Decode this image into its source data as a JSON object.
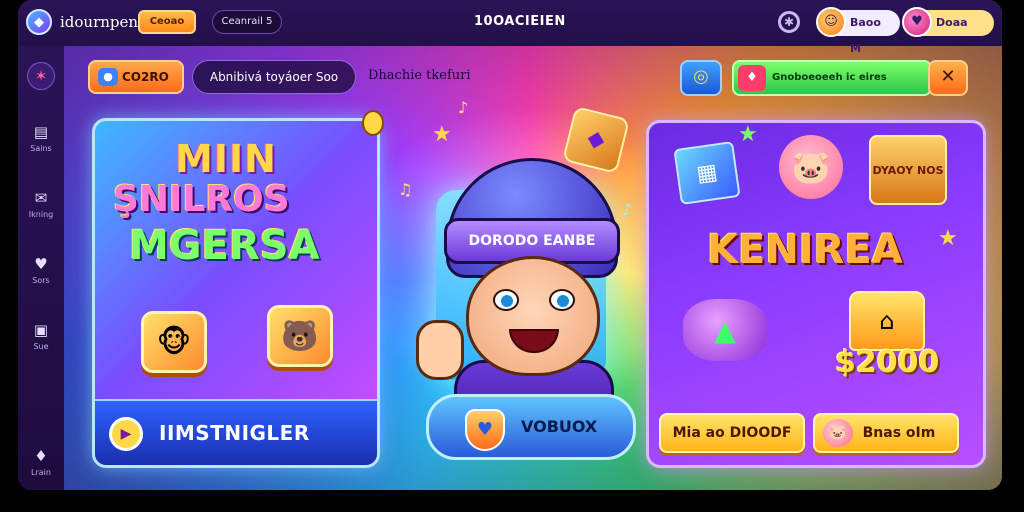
{
  "topbar": {
    "app_title": "idournpen",
    "orange_button_label": "Ceoao",
    "dark_button_label": "Ceanrail 5",
    "center_title": "10OACIEIEN",
    "chip1_label": "Baoo M",
    "chip2_label": "Doaa"
  },
  "sidebar": {
    "items": [
      {
        "label": "",
        "icon": "home-icon"
      },
      {
        "label": "Sains",
        "icon": "book-icon"
      },
      {
        "label": "Ikning",
        "icon": "mail-icon"
      },
      {
        "label": "Sors",
        "icon": "heart-icon"
      },
      {
        "label": "Sue",
        "icon": "gift-icon"
      },
      {
        "label": "Lrain",
        "icon": "pin-icon"
      }
    ]
  },
  "toolbar": {
    "pill_label": "CO2RO",
    "search_text": "Abnibivá toyáoer Soo",
    "sub_label": "Dhachie tkefuri",
    "green_bar_label": "Gnoboeoeeh ic eires"
  },
  "left_card": {
    "title_line1": "MIIN",
    "title_line2": "ŞNILROS",
    "title_line3": "MGERSA",
    "bottom_label": "IIMSTNIGLER"
  },
  "center": {
    "hat_text": "DORODO EANBE",
    "ring_label": "VOBUOX"
  },
  "right_card": {
    "title": "KENIREA",
    "chest_label": "DYAOY NOS",
    "amount": "$2000",
    "button1_label": "Mia ao DIOODF",
    "button2_label": "Bnas oIm"
  },
  "colors": {
    "topbar_bg": "#2a1457",
    "accent_orange": "#ff8a1a",
    "accent_green": "#2ec64a",
    "accent_yellow": "#ffd84a"
  }
}
